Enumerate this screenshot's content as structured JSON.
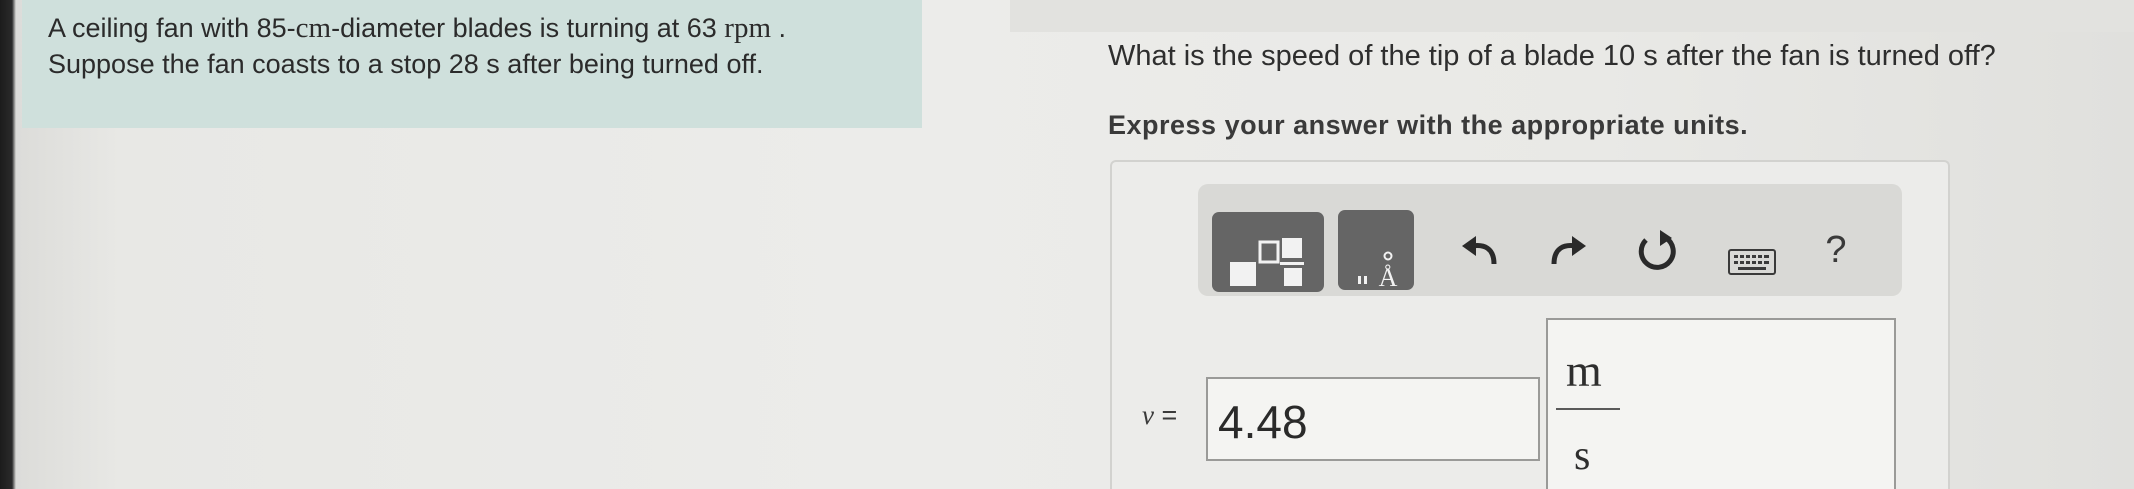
{
  "problem": {
    "line1_part1": "A ceiling fan with 85-",
    "line1_unit": "cm",
    "line1_part2": "-diameter blades is turning at 63 ",
    "line1_rpm": "rpm",
    "line1_end": " .",
    "line2": "Suppose the fan coasts to a stop 28 s after being turned off."
  },
  "question": "What is the speed of the tip of a blade 10 s after the fan is turned off?",
  "instruction": "Express your answer with the appropriate units.",
  "toolbar": {
    "templates_icon": "fraction-template-icon",
    "units_icon": "units-angstrom-icon",
    "units_label": "Å",
    "undo_icon": "undo-icon",
    "redo_icon": "redo-icon",
    "reset_icon": "reset-icon",
    "keyboard_icon": "keyboard-icon",
    "help_label": "?"
  },
  "answer": {
    "variable": "v",
    "equals": "=",
    "value": "4.48",
    "unit_numerator": "m",
    "unit_denominator": "s"
  },
  "colors": {
    "problem_bg": "#cfe0dc",
    "toolbar_bg": "#d9d9d6",
    "dark_button": "#656565"
  }
}
